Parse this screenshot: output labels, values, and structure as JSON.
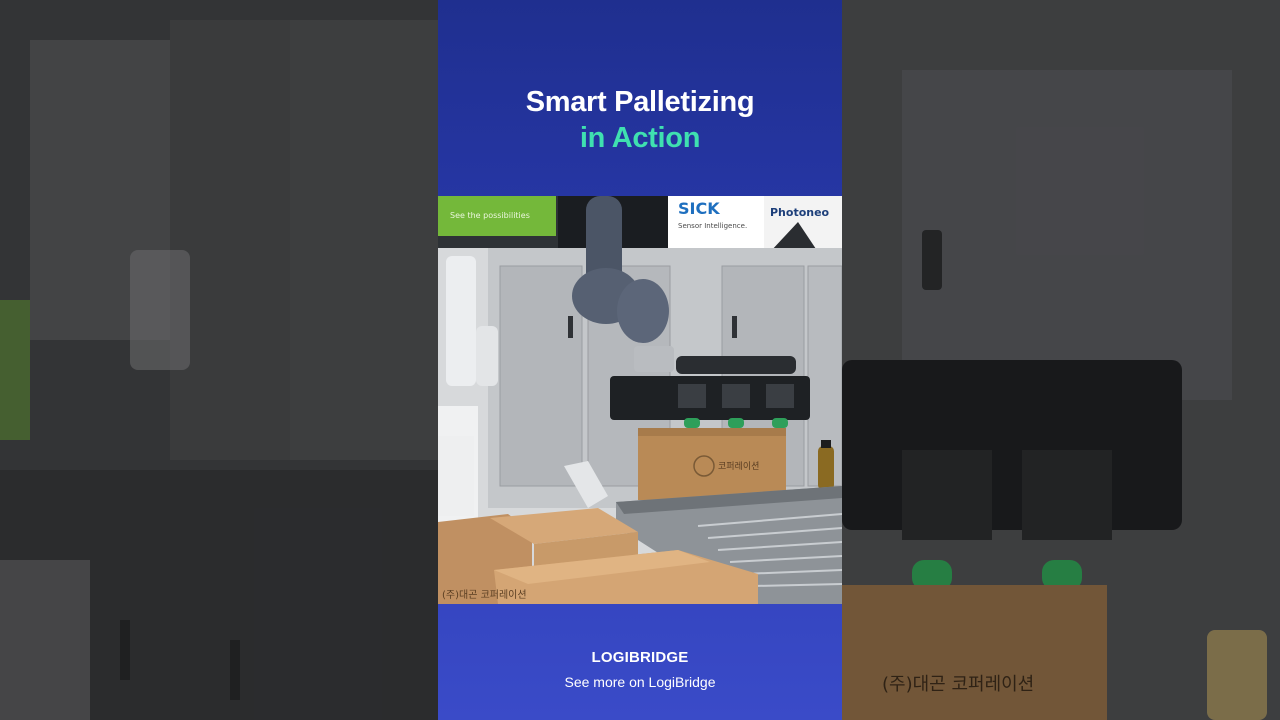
{
  "title": {
    "line1": "Smart Palletizing",
    "line2": "in Action"
  },
  "photo": {
    "banner_sick": "SICK",
    "banner_sick_sub": "Sensor Intelligence.",
    "banner_photoneo": "Photoneo",
    "banner_left_sub": "See the possibilities",
    "box_label": "(주)대곤 코퍼레이션",
    "box_label_small": "코퍼레이션"
  },
  "background": {
    "box_label": "(주)대곤 코퍼레이션"
  },
  "footer": {
    "brand": "LOGIBRIDGE",
    "link_text": "See more on LogiBridge"
  },
  "colors": {
    "title_primary": "#ffffff",
    "title_accent": "#3fe0b0",
    "panel_top": "#1f2f8f",
    "panel_bottom": "#3a4bc8"
  }
}
